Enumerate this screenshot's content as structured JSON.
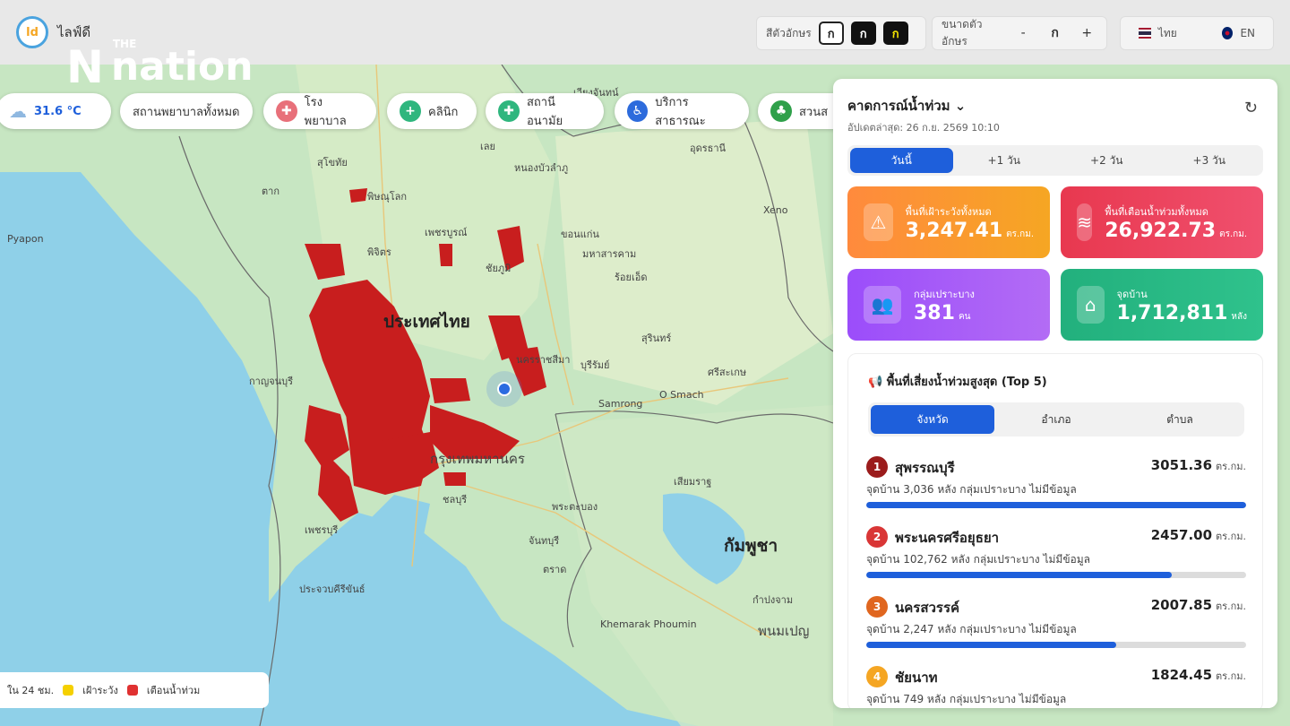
{
  "header": {
    "app_name": "ไลฟ์ดี",
    "font_color_label": "สีตัวอักษร",
    "font_color_options": [
      "ก",
      "ก",
      "ก"
    ],
    "font_size_label": "ขนาดตัวอักษร",
    "font_size_decrease": "-",
    "font_size_current": "ก",
    "font_size_increase": "+",
    "lang_th": "ไทย",
    "lang_en": "EN"
  },
  "watermark": {
    "the": "THE",
    "word": "nation"
  },
  "weather": {
    "temp": "31.6 °C"
  },
  "filters": [
    {
      "label": "สถานพยาบาลทั้งหมด",
      "icon": ""
    },
    {
      "label": "โรงพยาบาล",
      "icon": "hospital-icon"
    },
    {
      "label": "คลินิก",
      "icon": "clinic-icon"
    },
    {
      "label": "สถานีอนามัย",
      "icon": "health-station-icon"
    },
    {
      "label": "บริการสาธารณะ",
      "icon": "accessibility-icon"
    },
    {
      "label": "สวนส",
      "icon": "park-icon"
    }
  ],
  "map_labels": {
    "thailand": "ประเทศไทย",
    "cambodia": "กัมพูชา",
    "bangkok": "กรุงเทพมหานคร",
    "phnom_penh": "พนมเปญ",
    "others": [
      "เวียงจันทน์",
      "อุดรธานี",
      "เลย",
      "หนองบัวลำภู",
      "สุโขทัย",
      "พิษณุโลก",
      "พิจิตร",
      "เพชรบูรณ์",
      "ขอนแก่น",
      "มหาสารคาม",
      "ร้อยเอ็ด",
      "ชัยภูมิ",
      "นครราชสีมา",
      "บุรีรัมย์",
      "สุรินทร์",
      "ศรีสะเกษ",
      "ตาก",
      "กาญจนบุรี",
      "เพชรบุรี",
      "ประจวบคีรีขันธ์",
      "ชลบุรี",
      "จันทบุรี",
      "ตราด",
      "พระตะบอง",
      "เสียมราฐ",
      "กำปงจาม",
      "Xeno",
      "Samrong",
      "O Smach",
      "Pyapon",
      "Khemarak Phoumin"
    ]
  },
  "legend": {
    "period": "ใน 24 ชม.",
    "watch": "เฝ้าระวัง",
    "warn": "เตือนน้ำท่วม",
    "watch_color": "#f5d000",
    "warn_color": "#e03131"
  },
  "panel": {
    "title": "คาดการณ์น้ำท่วม",
    "updated": "อัปเดตล่าสุด: 26 ก.ย. 2569 10:10",
    "day_tabs": [
      "วันนี้",
      "+1 วัน",
      "+2 วัน",
      "+3 วัน"
    ],
    "stats": [
      {
        "label": "พื้นที่เฝ้าระวังทั้งหมด",
        "value": "3,247.41",
        "unit": "ตร.กม.",
        "icon": "warning-icon",
        "color_from": "#ff8a3d",
        "color_to": "#f6a623"
      },
      {
        "label": "พื้นที่เตือนน้ำท่วมทั้งหมด",
        "value": "26,922.73",
        "unit": "ตร.กม.",
        "icon": "waves-icon",
        "color_from": "#e8384f",
        "color_to": "#f0506e"
      },
      {
        "label": "กลุ่มเปราะบาง",
        "value": "381",
        "unit": "คน",
        "icon": "people-icon",
        "color_from": "#9b4dfa",
        "color_to": "#b36cf5"
      },
      {
        "label": "จุดบ้าน",
        "value": "1,712,811",
        "unit": "หลัง",
        "icon": "house-icon",
        "color_from": "#22b07d",
        "color_to": "#2fc28c"
      }
    ],
    "top5_title": "พื้นที่เสี่ยงน้ำท่วมสูงสุด (Top 5)",
    "level_tabs": [
      "จังหวัด",
      "อำเภอ",
      "ตำบล"
    ],
    "rows": [
      {
        "rank": "1",
        "name": "สุพรรณบุรี",
        "area": "3051.36",
        "unit": "ตร.กม.",
        "meta": "จุดบ้าน 3,036 หลัง   กลุ่มเปราะบาง ไม่มีข้อมูล",
        "fill": 1.0,
        "color": "#9b1c1c"
      },
      {
        "rank": "2",
        "name": "พระนครศรีอยุธยา",
        "area": "2457.00",
        "unit": "ตร.กม.",
        "meta": "จุดบ้าน 102,762 หลัง   กลุ่มเปราะบาง ไม่มีข้อมูล",
        "fill": 0.805,
        "color": "#d93636"
      },
      {
        "rank": "3",
        "name": "นครสวรรค์",
        "area": "2007.85",
        "unit": "ตร.กม.",
        "meta": "จุดบ้าน 2,247 หลัง   กลุ่มเปราะบาง ไม่มีข้อมูล",
        "fill": 0.658,
        "color": "#e0661f"
      },
      {
        "rank": "4",
        "name": "ชัยนาท",
        "area": "1824.45",
        "unit": "ตร.กม.",
        "meta": "จุดบ้าน 749 หลัง   กลุ่มเปราะบาง ไม่มีข้อมูล",
        "fill": 0.598,
        "color": "#f5a623"
      }
    ]
  }
}
